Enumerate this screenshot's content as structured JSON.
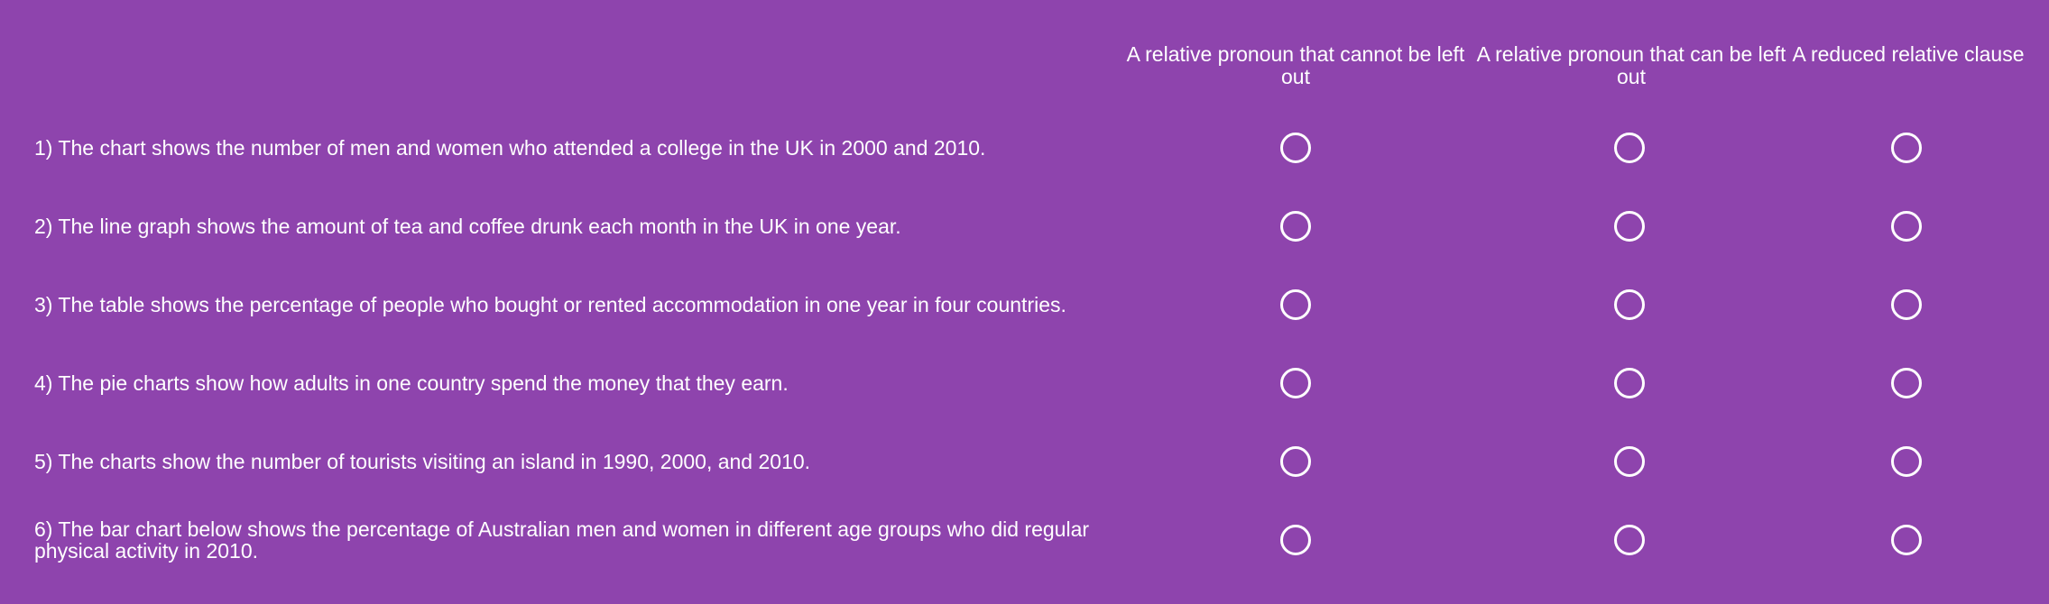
{
  "columns": [
    "A relative pronoun that cannot be left out",
    "A relative pronoun that can be left out",
    "A reduced relative clause"
  ],
  "questions": [
    "1) The chart shows the number of men and women who attended a college in the UK in 2000 and 2010.",
    "2) The line graph shows the amount of tea and coffee drunk each month in the UK in one year.",
    "3) The table shows the percentage of people who bought or rented accommodation in one year in four countries.",
    "4) The pie charts show how adults in one country spend the money that they earn.",
    "5) The charts show the number of tourists visiting an island in 1990, 2000, and 2010.",
    "6) The bar chart below shows the percentage of Australian men and women in different age groups who did regular physical activity in 2010."
  ],
  "colors": {
    "background": "#8e44ad",
    "text": "#ffffff"
  }
}
